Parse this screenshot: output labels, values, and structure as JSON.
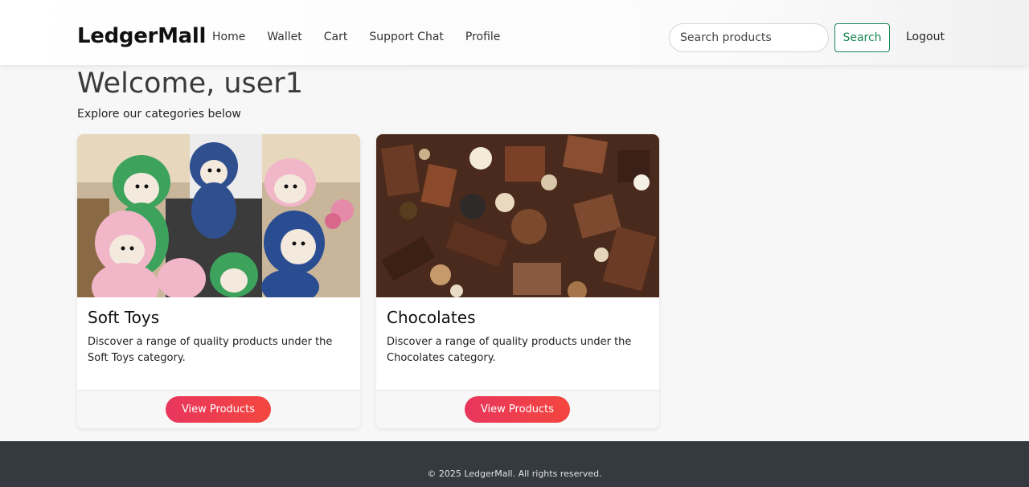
{
  "brand": "LedgerMall",
  "nav": {
    "links": [
      "Home",
      "Wallet",
      "Cart",
      "Support Chat",
      "Profile"
    ],
    "search_placeholder": "Search products",
    "search_button": "Search",
    "logout": "Logout",
    "accent_color": "#198754"
  },
  "main": {
    "welcome": "Welcome, user1",
    "subtitle": "Explore our categories below"
  },
  "categories": [
    {
      "title": "Soft Toys",
      "description": "Discover a range of quality products under the Soft Toys category.",
      "button": "View Products",
      "image_icon": "soft-toys-image"
    },
    {
      "title": "Chocolates",
      "description": "Discover a range of quality products under the Chocolates category.",
      "button": "View Products",
      "image_icon": "chocolates-image"
    }
  ],
  "footer": {
    "text": "© 2025 LedgerMall. All rights reserved.",
    "background": "#343a40"
  },
  "colors": {
    "button_gradient_start": "#e8365d",
    "button_gradient_end": "#f4463f"
  }
}
